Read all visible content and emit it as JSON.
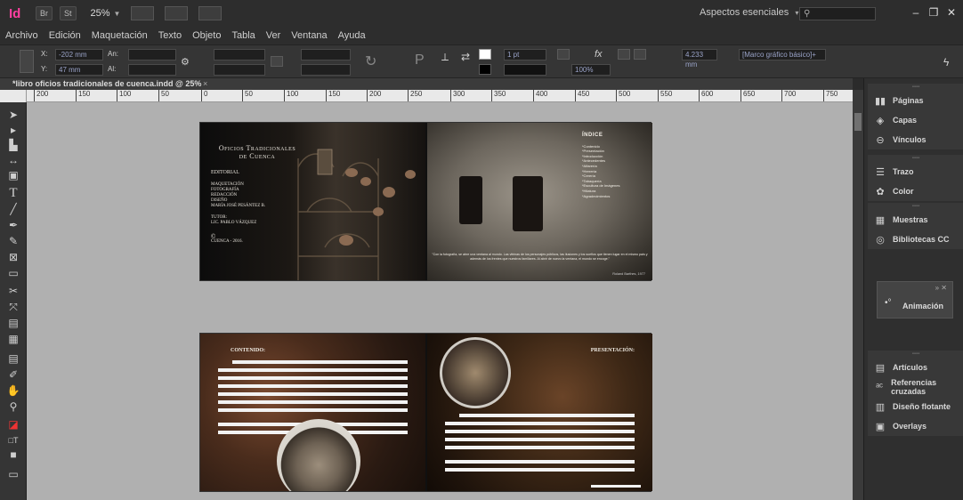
{
  "app": {
    "id_label": "Id",
    "bridge_label": "Br",
    "stock_label": "St",
    "zoom": "25%",
    "workspace": "Aspectos esenciales"
  },
  "menu": [
    "Archivo",
    "Edición",
    "Maquetación",
    "Texto",
    "Objeto",
    "Tabla",
    "Ver",
    "Ventana",
    "Ayuda"
  ],
  "control": {
    "x": "-202 mm",
    "y": "47 mm",
    "w_label": "An:",
    "h_label": "Al:",
    "stroke": "1 pt",
    "opacity": "100%",
    "dimension": "4.233 mm",
    "frame_style": "[Marco gráfico básico]+"
  },
  "doc_tab": {
    "title": "*libro oficios tradicionales de cuenca.indd @ 25%",
    "close": "×"
  },
  "ruler_ticks": [
    "200",
    "150",
    "100",
    "50",
    "0",
    "50",
    "100",
    "150",
    "200",
    "250",
    "300",
    "350",
    "400",
    "450",
    "500",
    "550",
    "600",
    "650",
    "700",
    "750"
  ],
  "spread1": {
    "left": {
      "title_line1": "Oficios Tradicionales",
      "title_line2": "de Cuenca",
      "editorial": "EDITORIAL",
      "credits": [
        "MAQUETACIÓN",
        "FOTOGRAFÍA",
        "REDACCIÓN",
        "DISEÑO",
        "MARÍA JOSÉ PESÁNTEZ B."
      ],
      "tutor_label": "TUTOR:",
      "tutor_name": "LIC. PABLO VÁZQUEZ",
      "copyright": "©",
      "place_year": "CUENCA - 2016."
    },
    "right": {
      "index_title": "ÍNDICE",
      "index_items": [
        "*Contenido",
        "*Presentación",
        "*Introducción",
        "*Antecedentes",
        "*Alfarería",
        "*Herrería",
        "*Cerería",
        "*Tabaquería",
        "*Escultura de Imágenes",
        "*Hilatura",
        "*Agradecimientos"
      ],
      "quote": "\"Con la fotografía, se abre una ventana al mundo. Las vitrinas de los personajes públicos, las ilusiones y los sueños que tienen lugar en el mismo país y además de los frentes que nuestros familiares. Al abrir de nuevo la ventana, el mundo se encoge.\"",
      "quote_author": "Roland Barthes, 1977"
    }
  },
  "spread2": {
    "left_heading": "CONTENIDO:",
    "right_heading": "PRESENTACIÓN:"
  },
  "panels": {
    "group1": [
      {
        "icon": "pages-icon",
        "glyph": "▮▮",
        "label": "Páginas"
      },
      {
        "icon": "layers-icon",
        "glyph": "◈",
        "label": "Capas"
      },
      {
        "icon": "links-icon",
        "glyph": "⊖",
        "label": "Vínculos"
      }
    ],
    "group2": [
      {
        "icon": "stroke-icon",
        "glyph": "☰",
        "label": "Trazo"
      },
      {
        "icon": "color-icon",
        "glyph": "✿",
        "label": "Color"
      }
    ],
    "group3": [
      {
        "icon": "swatches-icon",
        "glyph": "▦",
        "label": "Muestras"
      },
      {
        "icon": "cc-libraries-icon",
        "glyph": "◎",
        "label": "Bibliotecas CC"
      }
    ],
    "animation": {
      "icon": "animation-icon",
      "glyph": "•°",
      "label": "Animación"
    },
    "group4": [
      {
        "icon": "articles-icon",
        "glyph": "▤",
        "label": "Artículos"
      },
      {
        "icon": "cross-references-icon",
        "glyph": "ᵃᶜ",
        "label": "Referencias cruzadas"
      },
      {
        "icon": "floating-layout-icon",
        "glyph": "▥",
        "label": "Diseño flotante"
      },
      {
        "icon": "overlays-icon",
        "glyph": "▣",
        "label": "Overlays"
      }
    ]
  }
}
